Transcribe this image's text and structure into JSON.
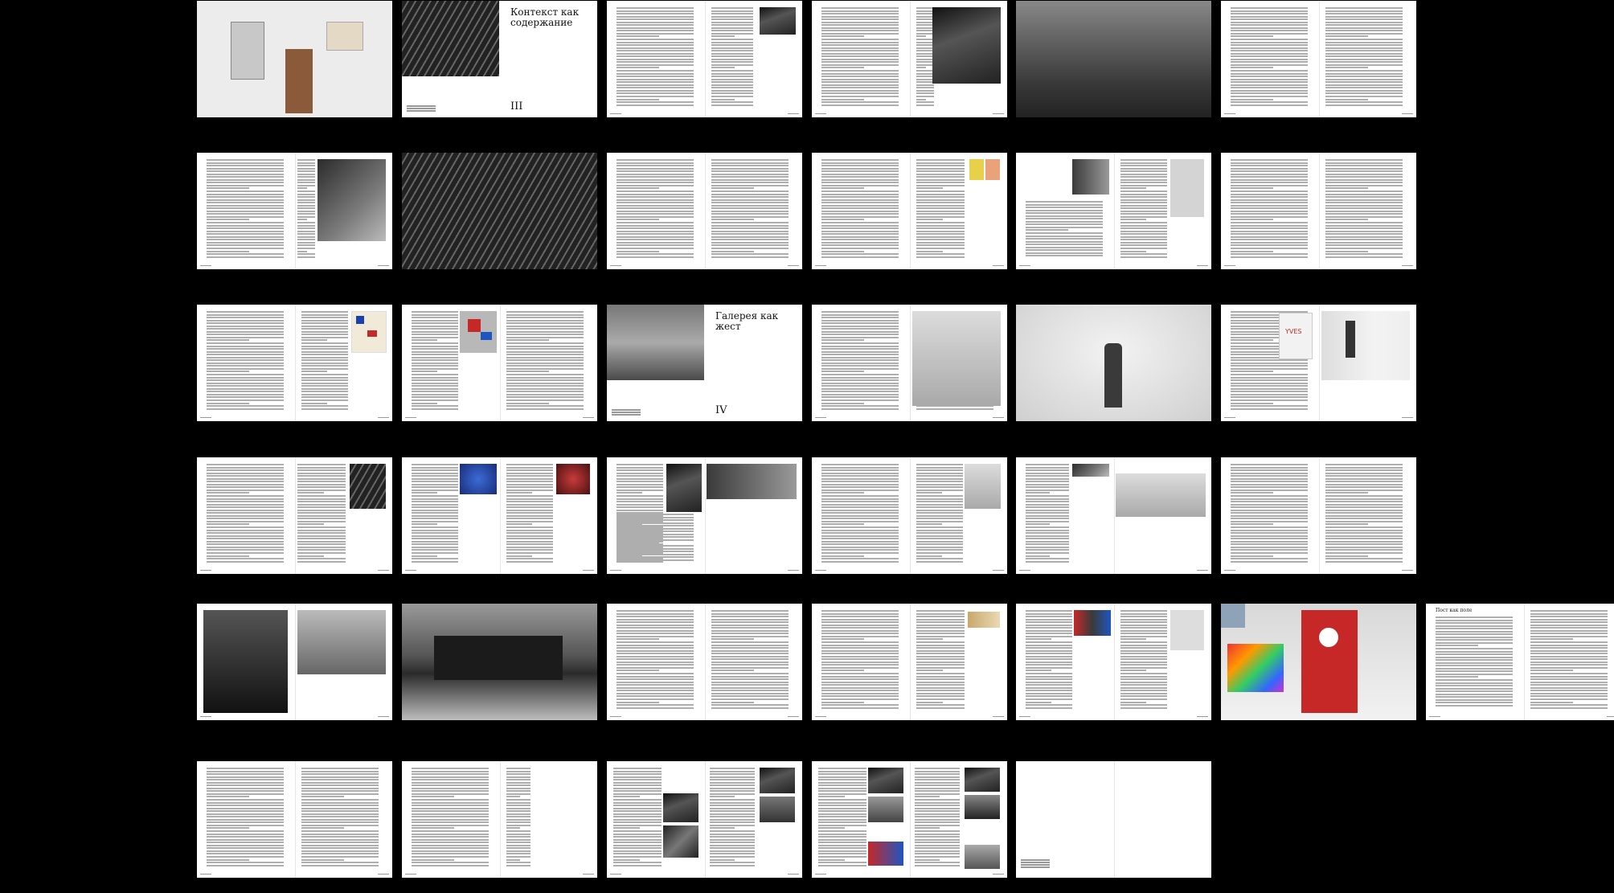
{
  "document": {
    "chapters": [
      {
        "title": "Контекст как содержание",
        "numeral": "III"
      },
      {
        "title": "Галерея как жест",
        "numeral": "IV"
      },
      {
        "title": "Пост как поле"
      }
    ],
    "poster_word": "YVES"
  }
}
